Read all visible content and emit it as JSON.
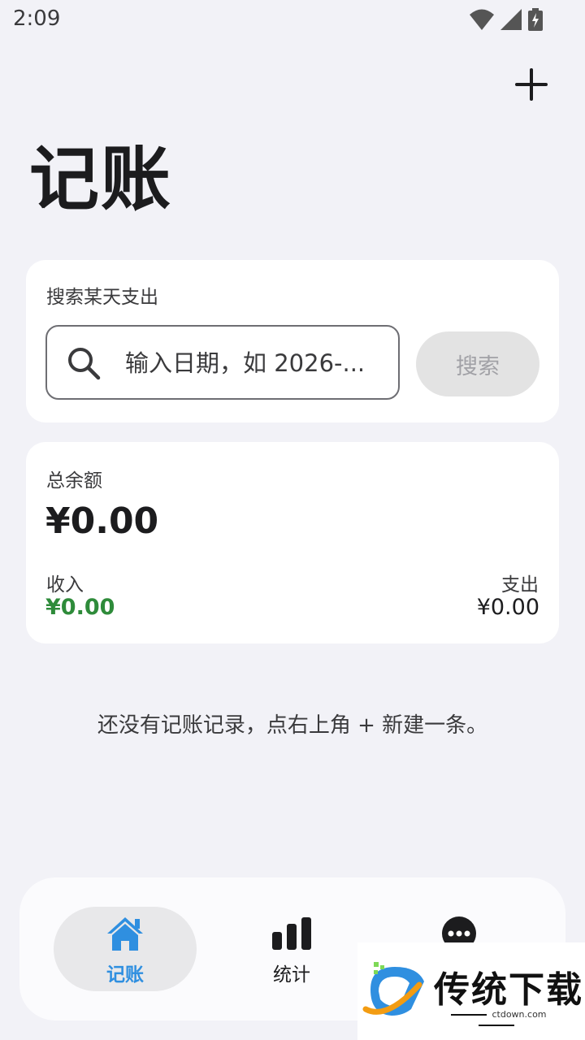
{
  "status_bar": {
    "time": "2:09"
  },
  "header": {
    "title": "记账"
  },
  "search": {
    "title": "搜索某天支出",
    "placeholder": "输入日期，如 2026-...",
    "button_label": "搜索"
  },
  "balance": {
    "label": "总余额",
    "value": "¥0.00",
    "income_label": "收入",
    "income_value": "¥0.00",
    "expense_label": "支出",
    "expense_value": "¥0.00"
  },
  "empty_hint": "还没有记账记录，点右上角 + 新建一条。",
  "bottom_nav": {
    "items": [
      {
        "label": "记账",
        "icon": "home-icon",
        "active": true
      },
      {
        "label": "统计",
        "icon": "bar-chart-icon",
        "active": false
      },
      {
        "label": "",
        "icon": "more-icon",
        "active": false
      }
    ]
  },
  "watermark": {
    "text": "传统下载",
    "sub": "ctdown.com"
  },
  "colors": {
    "accent": "#2f8fe0",
    "income": "#2e8b3a",
    "background": "#f2f2f7"
  }
}
